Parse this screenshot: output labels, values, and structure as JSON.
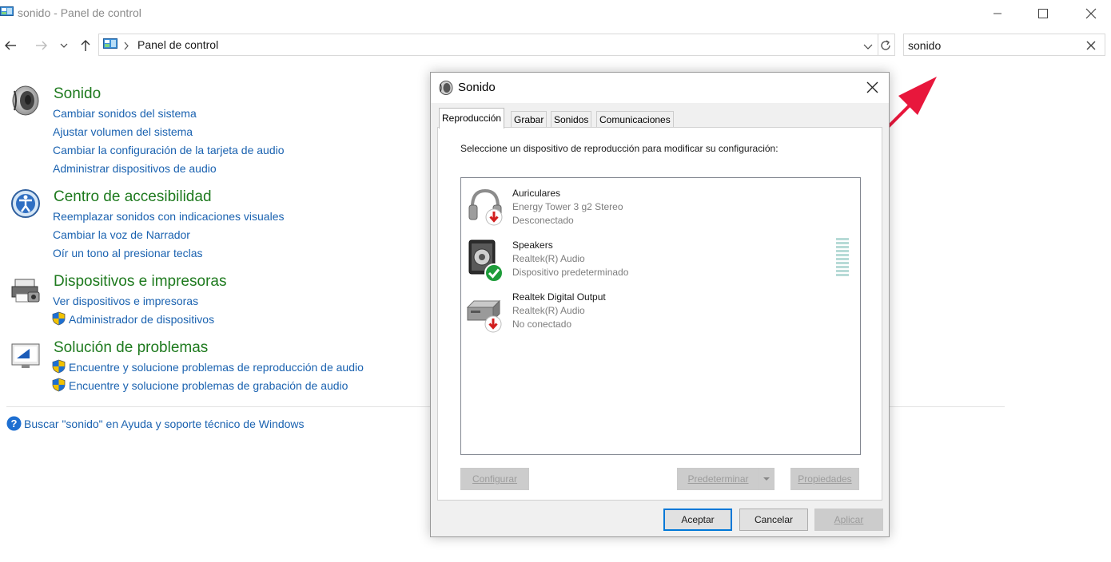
{
  "window": {
    "title": "sonido - Panel de control",
    "controls": [
      "minimize",
      "maximize",
      "close"
    ]
  },
  "address_bar": {
    "path": "Panel de control",
    "icons": [
      "back-arrow-icon",
      "forward-arrow-icon",
      "recent-dropdown-icon",
      "up-arrow-icon",
      "control-panel-icon",
      "chevron-right-icon",
      "dropdown-icon",
      "refresh-icon"
    ]
  },
  "search": {
    "value": "sonido"
  },
  "categories": [
    {
      "title": "Sonido",
      "icon": "speaker-icon",
      "links": [
        {
          "label": "Cambiar sonidos del sistema",
          "shield": false
        },
        {
          "label": "Ajustar volumen del sistema",
          "shield": false
        },
        {
          "label": "Cambiar la configuración de la tarjeta de audio",
          "shield": false
        },
        {
          "label": "Administrar dispositivos de audio",
          "shield": false
        }
      ]
    },
    {
      "title": "Centro de accesibilidad",
      "icon": "accessibility-icon",
      "links": [
        {
          "label": "Reemplazar sonidos con indicaciones visuales",
          "shield": false
        },
        {
          "label": "Cambiar la voz de Narrador",
          "shield": false
        },
        {
          "label": "Oír un tono al presionar teclas",
          "shield": false
        }
      ]
    },
    {
      "title": "Dispositivos e impresoras",
      "icon": "devices-printers-icon",
      "links": [
        {
          "label": "Ver dispositivos e impresoras",
          "shield": false
        },
        {
          "label": "Administrador de dispositivos",
          "shield": true
        }
      ]
    },
    {
      "title": "Solución de problemas",
      "icon": "troubleshooting-icon",
      "links": [
        {
          "label": "Encuentre y solucione problemas de reproducción de audio",
          "shield": true
        },
        {
          "label": "Encuentre y solucione problemas de grabación de audio",
          "shield": true
        }
      ]
    }
  ],
  "help_link": "Buscar \"sonido\" en Ayuda y soporte técnico de Windows",
  "dialog": {
    "title": "Sonido",
    "tabs": [
      "Reproducción",
      "Grabar",
      "Sonidos",
      "Comunicaciones"
    ],
    "active_tab": "Reproducción",
    "instruction": "Seleccione un dispositivo de reproducción para modificar su configuración:",
    "devices": [
      {
        "name": "Auriculares",
        "detail": "Energy Tower 3 g2 Stereo",
        "status": "Desconectado",
        "icon": "headphones-icon",
        "badge": "red-down-arrow"
      },
      {
        "name": "Speakers",
        "detail": "Realtek(R) Audio",
        "status": "Dispositivo predeterminado",
        "icon": "speaker-device-icon",
        "badge": "green-check"
      },
      {
        "name": "Realtek Digital Output",
        "detail": "Realtek(R) Audio",
        "status": "No conectado",
        "icon": "digital-output-icon",
        "badge": "red-down-arrow"
      }
    ],
    "buttons": {
      "configure": "Configurar",
      "set_default": "Predeterminar",
      "properties": "Propiedades",
      "ok": "Aceptar",
      "cancel": "Cancelar",
      "apply": "Aplicar"
    }
  },
  "colors": {
    "category_title": "#1e7a1e",
    "link": "#1a62b0",
    "annotation_arrow": "#e8173c",
    "default_button_border": "#0078d7"
  }
}
